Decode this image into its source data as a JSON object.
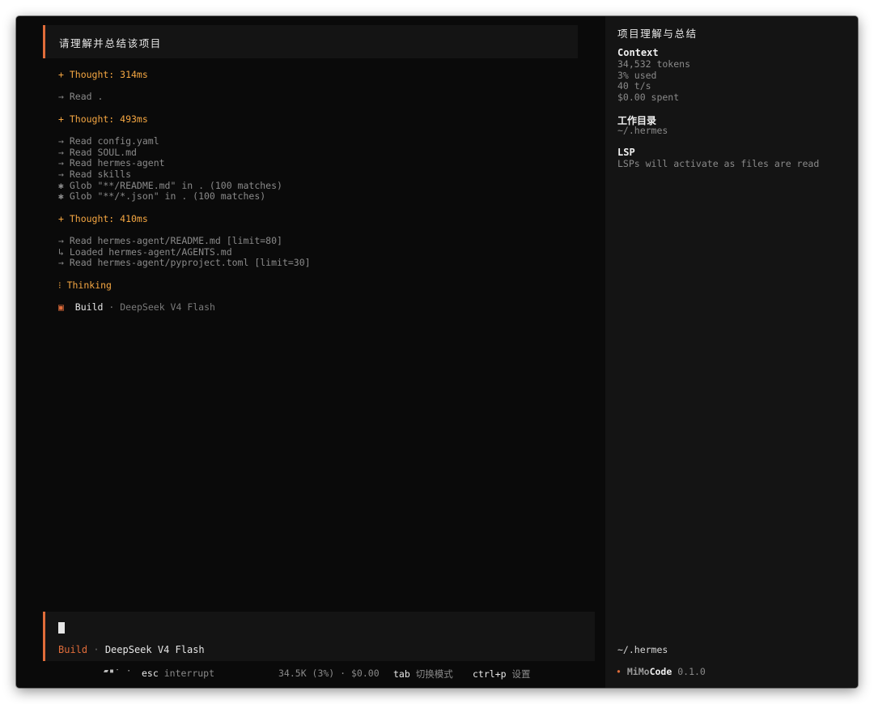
{
  "window": {
    "app_name": "MiMoCode"
  },
  "prompt": {
    "text": "请理解并总结该项目"
  },
  "log": [
    {
      "kind": "thought",
      "text": "+ Thought: 314ms"
    },
    {
      "kind": "tool",
      "text": "→ Read ."
    },
    {
      "kind": "thought",
      "text": "+ Thought: 493ms"
    },
    {
      "kind": "tool",
      "text": "→ Read config.yaml"
    },
    {
      "kind": "tool",
      "text": "→ Read SOUL.md"
    },
    {
      "kind": "tool",
      "text": "→ Read hermes-agent"
    },
    {
      "kind": "tool",
      "text": "→ Read skills"
    },
    {
      "kind": "tool",
      "text": "✱ Glob \"**/README.md\" in . (100 matches)"
    },
    {
      "kind": "tool",
      "text": "✱ Glob \"**/*.json\" in . (100 matches)"
    },
    {
      "kind": "thought",
      "text": "+ Thought: 410ms"
    },
    {
      "kind": "tool",
      "text": "→ Read hermes-agent/README.md [limit=80]"
    },
    {
      "kind": "tool",
      "text": "↳ Loaded hermes-agent/AGENTS.md"
    },
    {
      "kind": "tool",
      "text": "→ Read hermes-agent/pyproject.toml [limit=30]"
    },
    {
      "kind": "thinking",
      "text": "⁝ Thinking"
    }
  ],
  "build_status": {
    "icon": "▣",
    "mode": "Build",
    "separator": "·",
    "model": "DeepSeek V4 Flash"
  },
  "input": {
    "value": "",
    "mode": "Build",
    "separator": "·",
    "model": "DeepSeek V4 Flash"
  },
  "statusbar": {
    "spinner": "▰▪ˑ ·",
    "interrupt_key": "esc",
    "interrupt_label": "interrupt",
    "usage": "34.5K (3%) · $0.00",
    "tab_key": "tab",
    "tab_label": "切换模式",
    "ctrlp_key": "ctrl+p",
    "ctrlp_label": "设置"
  },
  "sidebar": {
    "title": "项目理解与总结",
    "context": {
      "heading": "Context",
      "tokens": "34,532 tokens",
      "used": "3% used",
      "rate": "40 t/s",
      "spent": "$0.00 spent"
    },
    "workdir": {
      "heading": "工作目录",
      "path": "~/.hermes"
    },
    "lsp": {
      "heading": "LSP",
      "message": "LSPs will activate as files are read"
    },
    "cwd_bottom": "~/.hermes",
    "brand": {
      "dot": "•",
      "mimo": "MiMo",
      "code": "Code",
      "version": "0.1.0"
    }
  }
}
